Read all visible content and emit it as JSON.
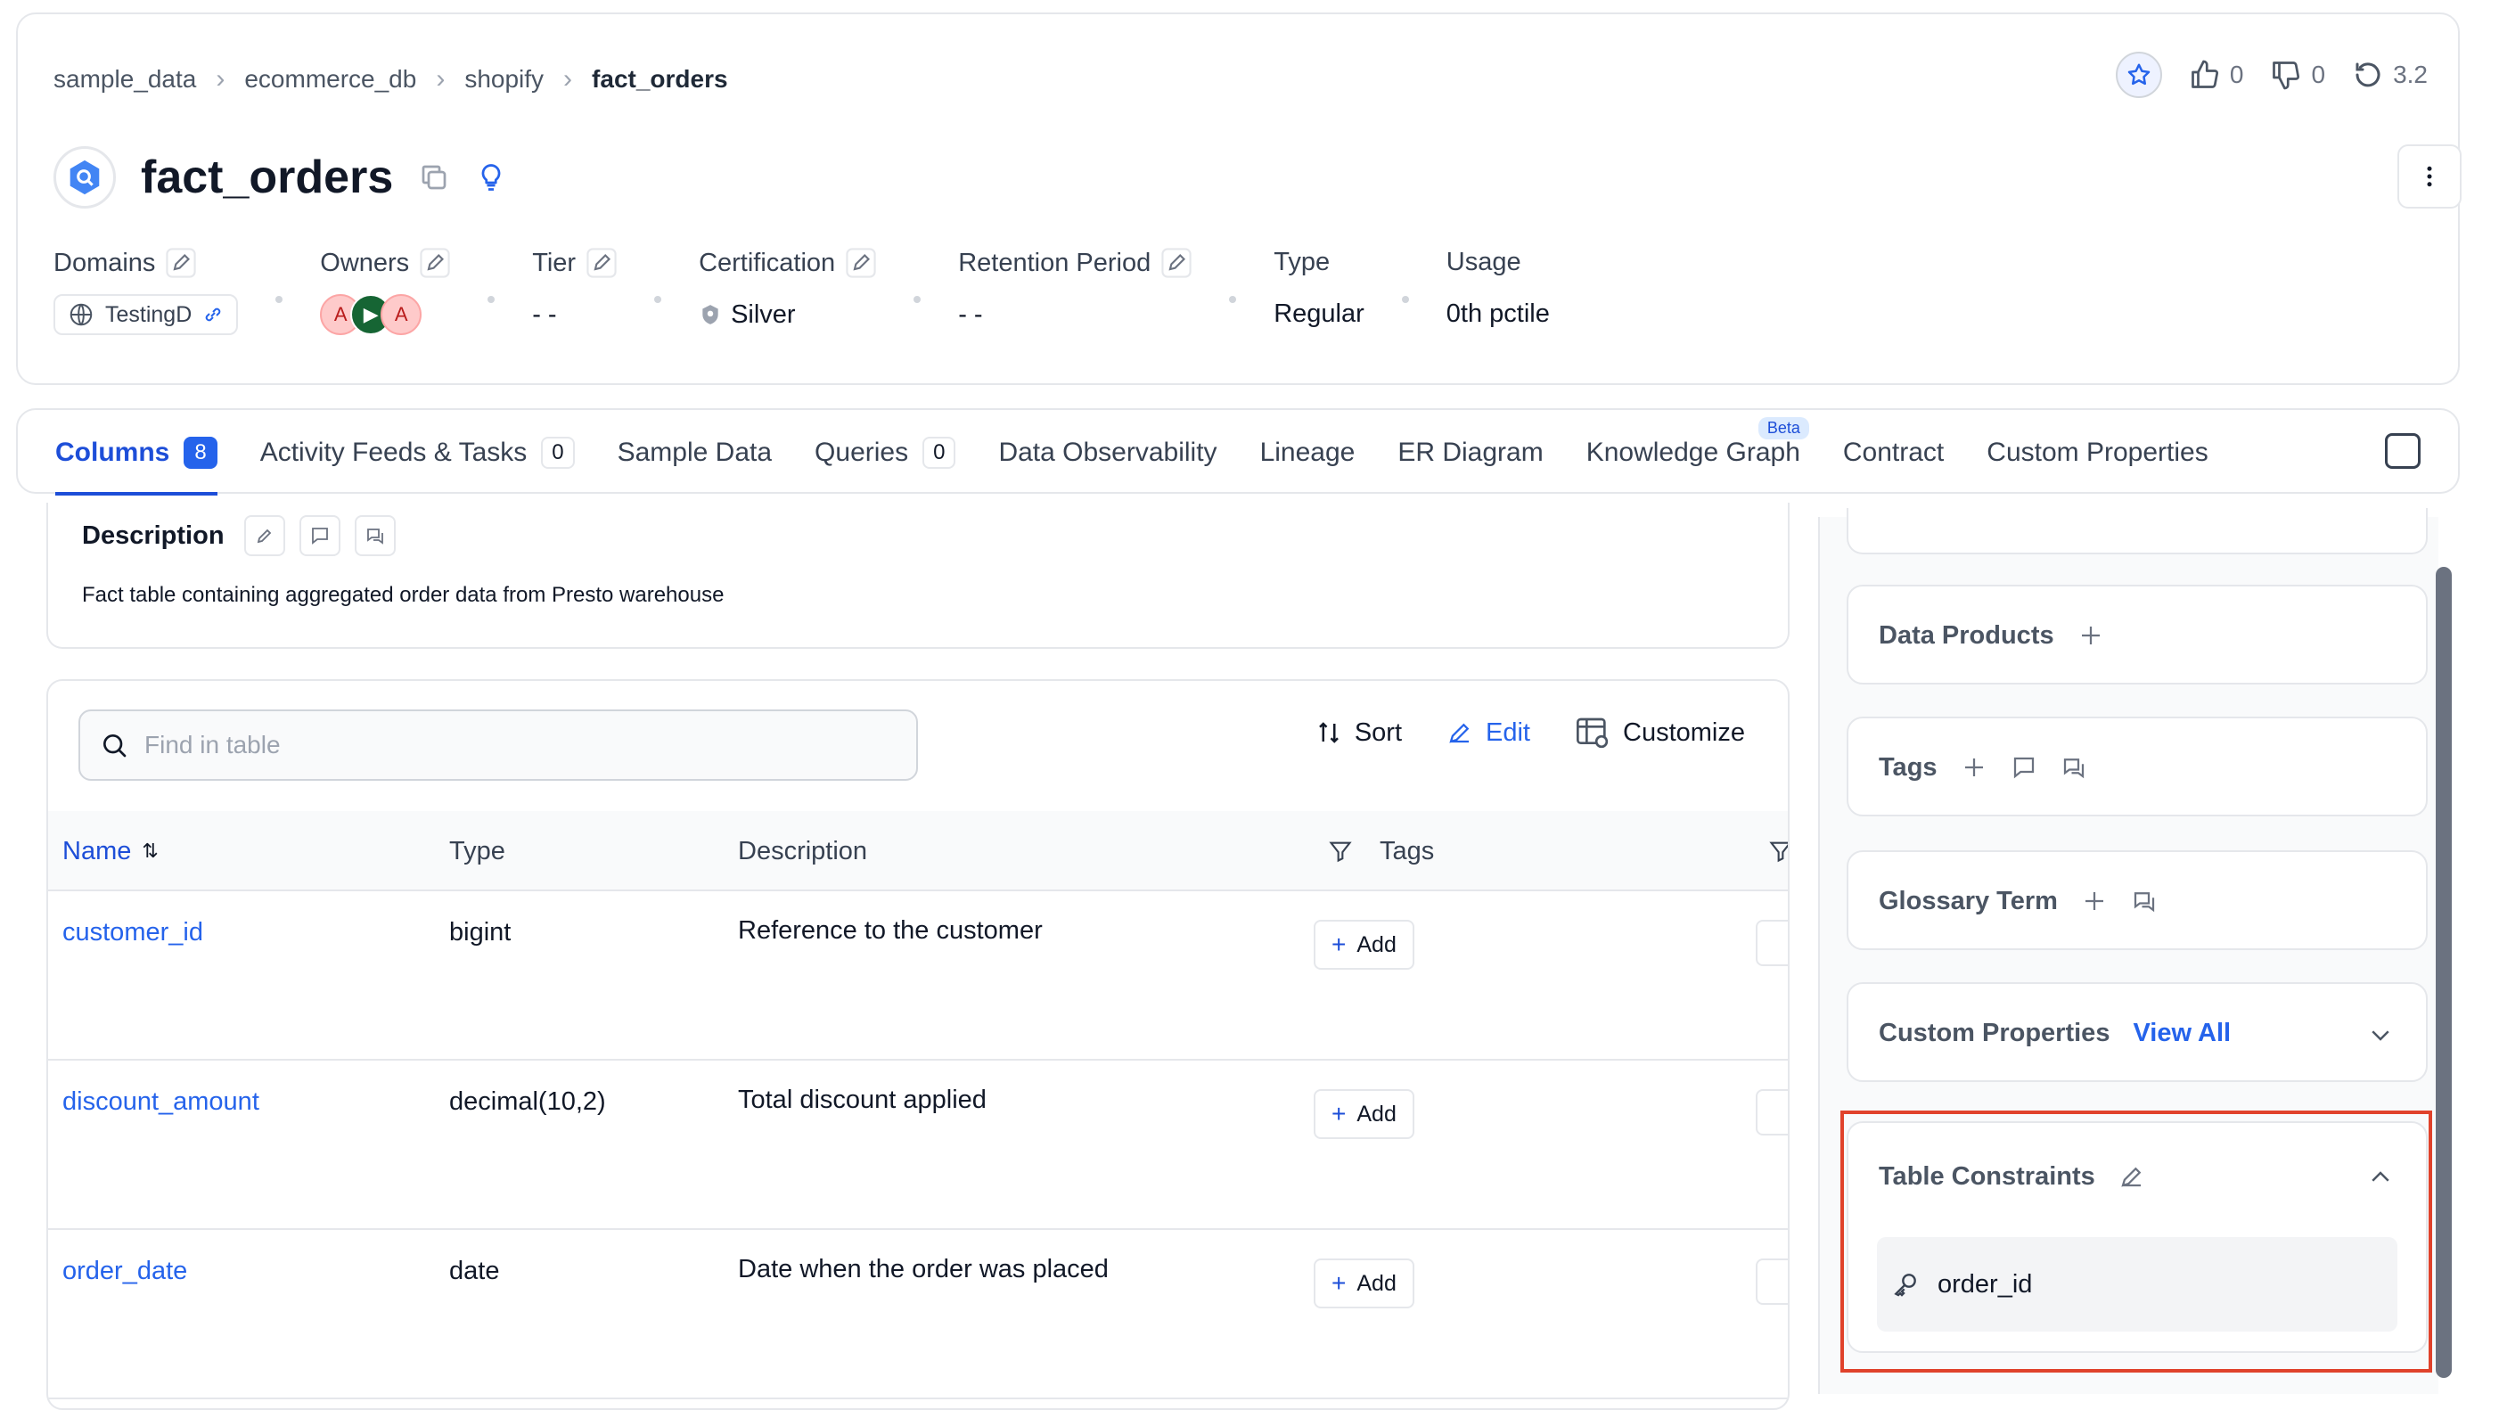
{
  "breadcrumb": [
    "sample_data",
    "ecommerce_db",
    "shopify",
    "fact_orders"
  ],
  "header_actions": {
    "likes": "0",
    "dislikes": "0",
    "version": "3.2"
  },
  "entity": {
    "title": "fact_orders"
  },
  "meta": {
    "domains": {
      "label": "Domains",
      "value": "TestingD"
    },
    "owners": {
      "label": "Owners",
      "avatars": [
        "A",
        "A"
      ]
    },
    "tier": {
      "label": "Tier",
      "value": "- -"
    },
    "certification": {
      "label": "Certification",
      "value": "Silver"
    },
    "retention": {
      "label": "Retention Period",
      "value": "- -"
    },
    "type": {
      "label": "Type",
      "value": "Regular"
    },
    "usage": {
      "label": "Usage",
      "value": "0th pctile"
    }
  },
  "tabs": [
    {
      "label": "Columns",
      "count": "8"
    },
    {
      "label": "Activity Feeds & Tasks",
      "count": "0"
    },
    {
      "label": "Sample Data"
    },
    {
      "label": "Queries",
      "count": "0"
    },
    {
      "label": "Data Observability"
    },
    {
      "label": "Lineage"
    },
    {
      "label": "ER Diagram"
    },
    {
      "label": "Knowledge Graph",
      "badge": "Beta"
    },
    {
      "label": "Contract"
    },
    {
      "label": "Custom Properties"
    }
  ],
  "description": {
    "title": "Description",
    "text": "Fact table containing aggregated order data from Presto warehouse"
  },
  "table": {
    "search_placeholder": "Find in table",
    "actions": {
      "sort": "Sort",
      "edit": "Edit",
      "customize": "Customize"
    },
    "headers": {
      "name": "Name",
      "type": "Type",
      "description": "Description",
      "tags": "Tags"
    },
    "add_label": "Add",
    "rows": [
      {
        "name": "customer_id",
        "type": "bigint",
        "description": "Reference to the customer"
      },
      {
        "name": "discount_amount",
        "type": "decimal(10,2)",
        "description": "Total discount applied"
      },
      {
        "name": "order_date",
        "type": "date",
        "description": "Date when the order was placed"
      }
    ]
  },
  "sidebar": {
    "data_products": "Data Products",
    "tags": "Tags",
    "glossary_term": "Glossary Term",
    "custom_properties": "Custom Properties",
    "view_all": "View All",
    "table_constraints": "Table Constraints",
    "constraint_value": "order_id"
  },
  "colors": {
    "accent": "#2563eb",
    "highlight": "#e0422b"
  }
}
